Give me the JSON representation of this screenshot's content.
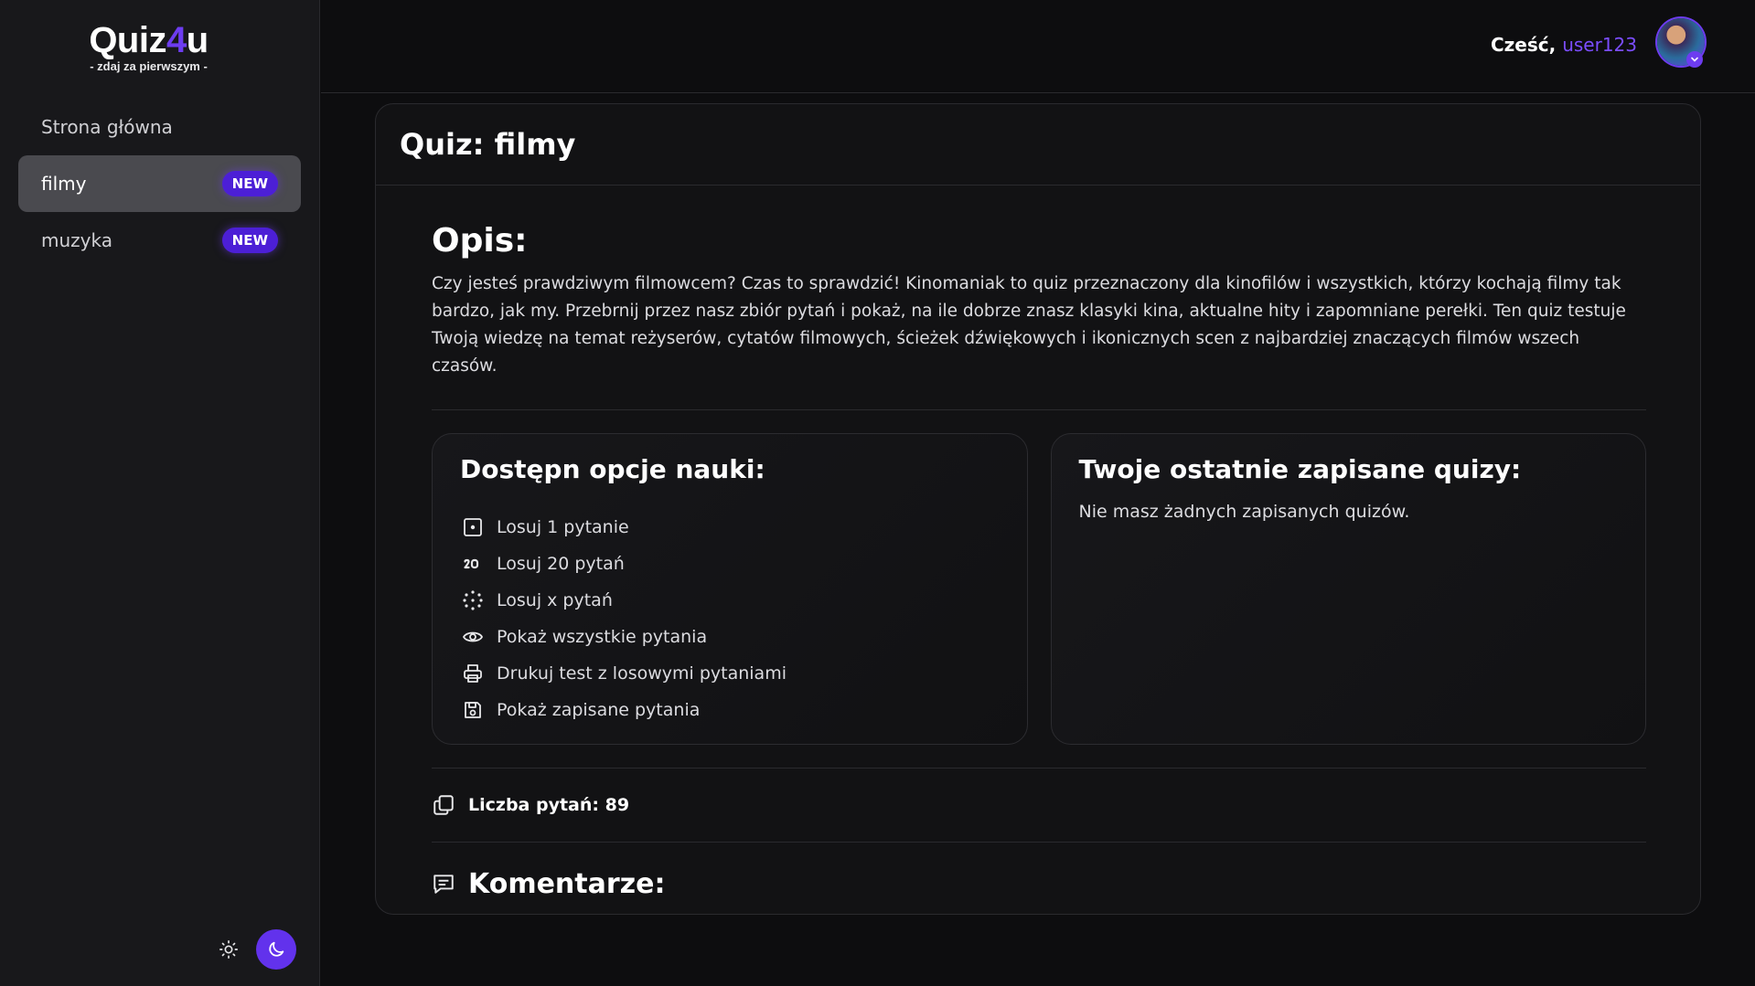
{
  "logo": {
    "main_prefix": "Quiz",
    "main_accent": "4",
    "main_suffix": "u",
    "tagline": "- zdaj za pierwszym -"
  },
  "sidebar": {
    "items": [
      {
        "label": "Strona główna",
        "badge": ""
      },
      {
        "label": "filmy",
        "badge": "NEW"
      },
      {
        "label": "muzyka",
        "badge": "NEW"
      }
    ]
  },
  "header": {
    "greeting": "Cześć,",
    "username": "user123"
  },
  "quiz": {
    "title": "Quiz: filmy",
    "description_title": "Opis:",
    "description": "Czy jesteś prawdziwym filmowcem? Czas to sprawdzić! Kinomaniak to quiz przeznaczony dla kinofilów i wszystkich, którzy kochają filmy tak bardzo, jak my. Przebrnij przez nasz zbiór pytań i pokaż, na ile dobrze znasz klasyki kina, aktualne hity i zapomniane perełki. Ten quiz testuje Twoją wiedzę na temat reżyserów, cytatów filmowych, ścieżek dźwiękowych i ikonicznych scen z najbardziej znaczących filmów wszech czasów.",
    "options_title": "Dostępn opcje nauki:",
    "options": [
      {
        "icon": "dice-one-icon",
        "label": "Losuj 1 pytanie"
      },
      {
        "icon": "number-20-icon",
        "label": "Losuj 20 pytań"
      },
      {
        "icon": "dots-scatter-icon",
        "label": "Losuj x pytań"
      },
      {
        "icon": "eye-icon",
        "label": "Pokaż wszystkie pytania"
      },
      {
        "icon": "printer-icon",
        "label": "Drukuj test z losowymi pytaniami"
      },
      {
        "icon": "save-icon",
        "label": "Pokaż zapisane pytania"
      }
    ],
    "saved_title": "Twoje ostatnie zapisane quizy:",
    "saved_empty": "Nie masz żadnych zapisanych quizów.",
    "question_count_label": "Liczba pytań: 89",
    "comments_title": "Komentarze:"
  },
  "colors": {
    "accent": "#6d3cf0",
    "badge": "#4c1fd6",
    "background": "#0d0d0f",
    "sidebar": "#18181b"
  }
}
